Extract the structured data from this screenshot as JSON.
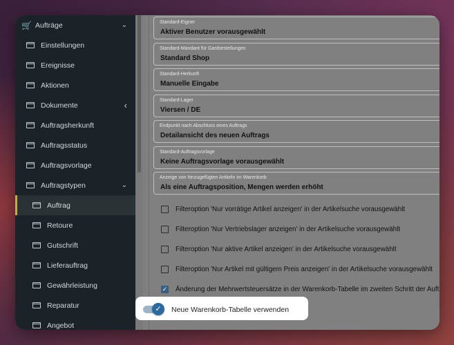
{
  "sidebar": {
    "items": [
      {
        "label": "Aufträge",
        "icon": "cart-icon",
        "chevron": "⌄"
      },
      {
        "label": "Einstellungen",
        "icon": "folder-icon"
      },
      {
        "label": "Ereignisse",
        "icon": "folder-icon"
      },
      {
        "label": "Aktionen",
        "icon": "folder-icon"
      },
      {
        "label": "Dokumente",
        "icon": "folder-icon",
        "chevron": "‹"
      },
      {
        "label": "Auftragsherkunft",
        "icon": "folder-icon"
      },
      {
        "label": "Auftragsstatus",
        "icon": "folder-icon"
      },
      {
        "label": "Auftragsvorlage",
        "icon": "folder-icon"
      },
      {
        "label": "Auftragstypen",
        "icon": "folder-icon",
        "chevron": "⌄"
      },
      {
        "label": "Auftrag",
        "icon": "folder-icon",
        "active": true
      },
      {
        "label": "Retoure",
        "icon": "folder-icon"
      },
      {
        "label": "Gutschrift",
        "icon": "folder-icon"
      },
      {
        "label": "Lieferauftrag",
        "icon": "folder-icon"
      },
      {
        "label": "Gewährleistung",
        "icon": "folder-icon"
      },
      {
        "label": "Reparatur",
        "icon": "folder-icon"
      },
      {
        "label": "Angebot",
        "icon": "folder-icon"
      }
    ]
  },
  "fields": [
    {
      "label": "Standard-Eigner",
      "value": "Aktiver Benutzer vorausgewählt"
    },
    {
      "label": "Standard-Mandant für Gastbestellungen",
      "value": "Standard Shop"
    },
    {
      "label": "Standard-Herkunft",
      "value": "Manuelle Eingabe"
    },
    {
      "label": "Standard-Lager",
      "value": "Viersen / DE"
    },
    {
      "label": "Endpunkt nach Abschluss eines Auftrags",
      "value": "Detailansicht des neuen Auftrags"
    },
    {
      "label": "Standard-Auftragsvorlage",
      "value": "Keine Auftragsvorlage vorausgewählt"
    },
    {
      "label": "Anzeige von hinzugefügten Artikeln im Warenkorb",
      "value": "Als eine Auftragsposition, Mengen werden erhöht"
    }
  ],
  "checkboxes": [
    {
      "label": "Filteroption 'Nur vorrätige Artikel anzeigen' in der Artikelsuche vorausgewählt",
      "checked": false
    },
    {
      "label": "Filteroption 'Nur Vertriebslager anzeigen' in der Artikelsuche vorausgewählt",
      "checked": false
    },
    {
      "label": "Filteroption 'Nur aktive Artikel anzeigen' in der Artikelsuche vorausgewählt",
      "checked": false
    },
    {
      "label": "Filteroption 'Nur Artikel mit gültigem Preis anzeigen' in der Artikelsuche vorausgewählt",
      "checked": false
    },
    {
      "label": "Änderung der Mehrwertsteuersätze in der Warenkorb-Tabelle im zweiten Schritt der Auftragserfassung",
      "checked": true
    }
  ],
  "toggle": {
    "label": "Neue Warenkorb-Tabelle verwenden",
    "on": true
  },
  "colors": {
    "accent": "#2c6a9e",
    "active_marker": "#c8a94a",
    "sidebar_bg": "#1c2328"
  }
}
